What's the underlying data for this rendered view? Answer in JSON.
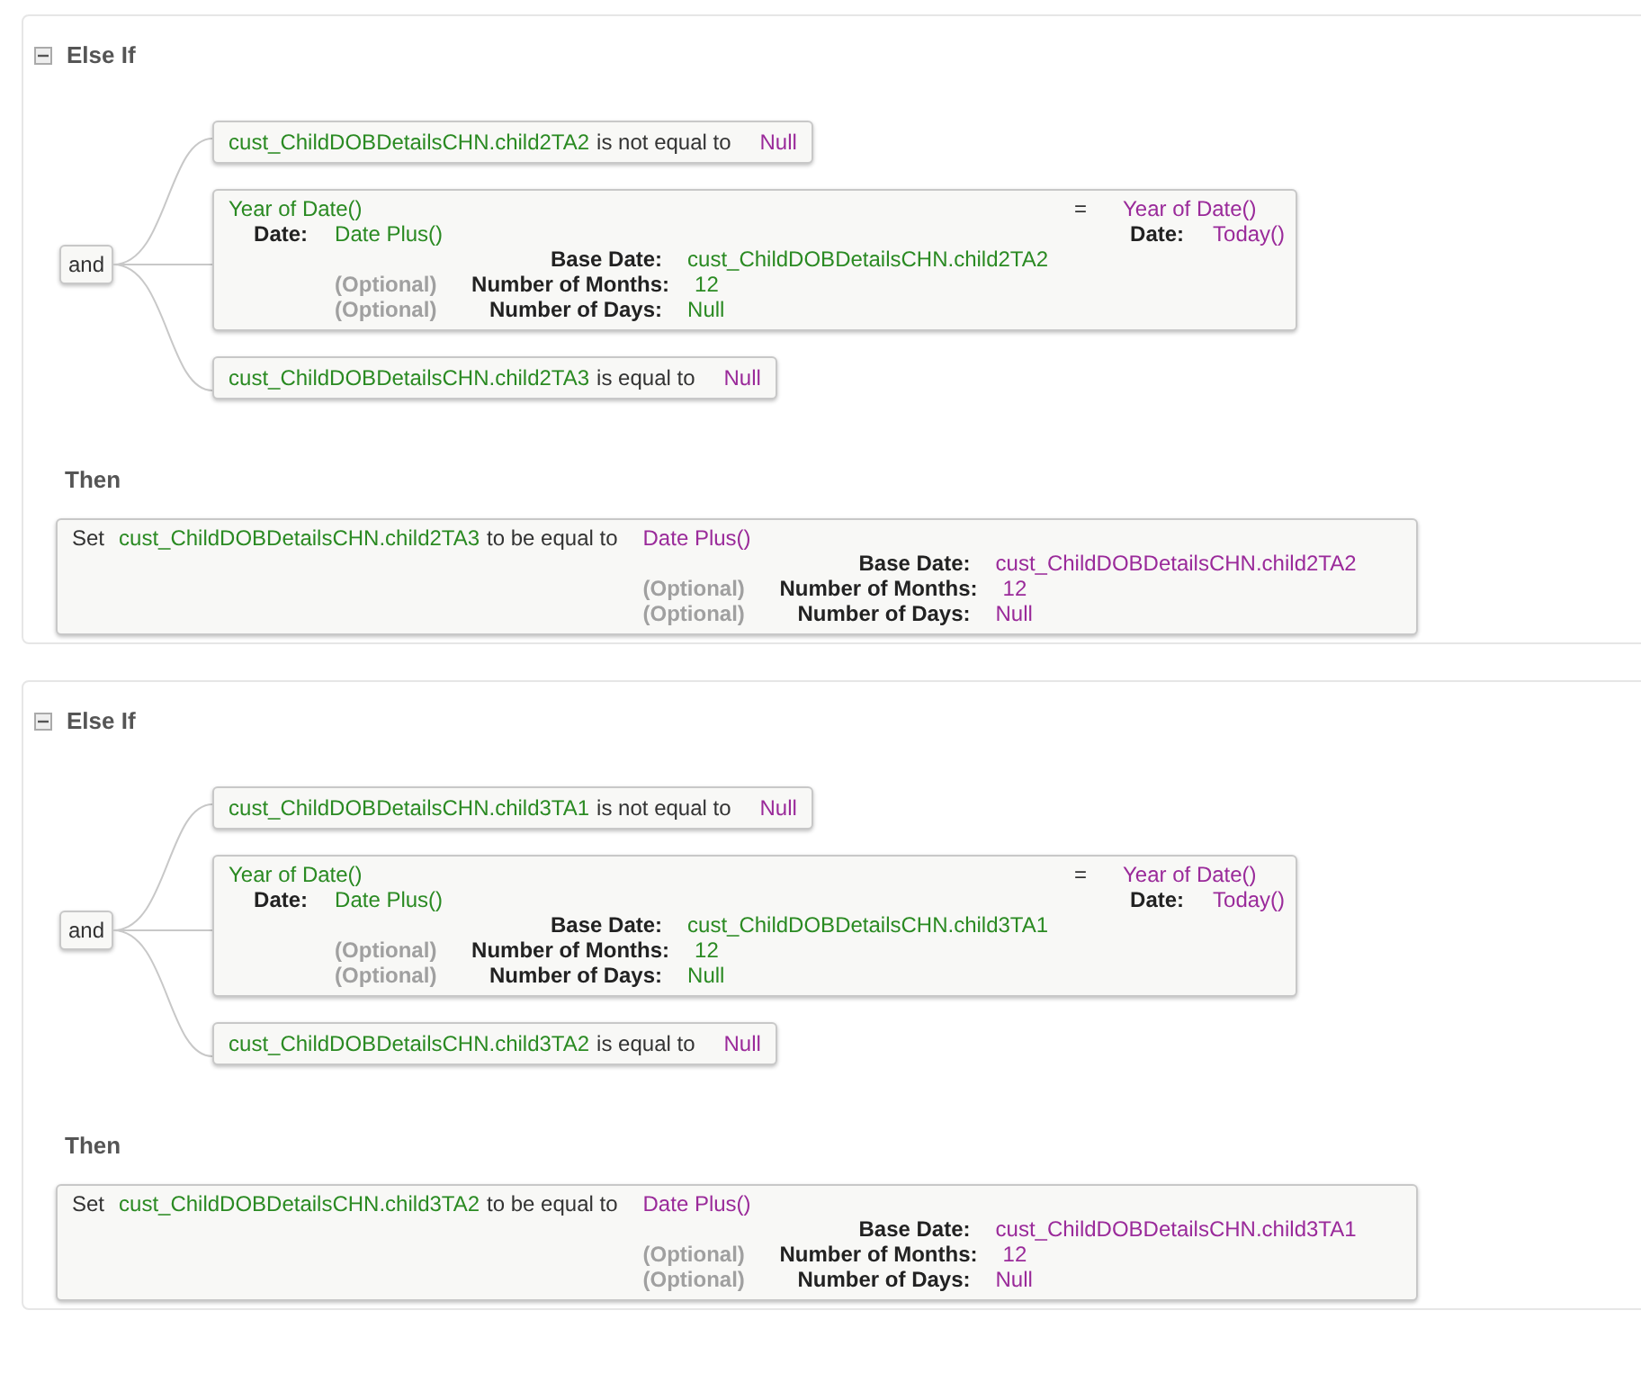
{
  "blocks": [
    {
      "heading": "Else If",
      "expanded": true,
      "operator": "and",
      "conditions": [
        {
          "kind": "compare",
          "field": "cust_ChildDOBDetailsCHN.child2TA2",
          "operator": "is not equal to",
          "value": "Null"
        },
        {
          "kind": "expression",
          "left": {
            "func": "Year of Date()",
            "arg_label": "Date:",
            "arg_func": "Date Plus()",
            "params": [
              {
                "label": "Base Date:",
                "value": "cust_ChildDOBDetailsCHN.child2TA2"
              },
              {
                "note": "(Optional)",
                "label": "Number of Months:",
                "value": "12"
              },
              {
                "note": "(Optional)",
                "label": "Number of Days:",
                "value": "Null"
              }
            ]
          },
          "operator": "=",
          "right": {
            "func": "Year of Date()",
            "arg_label": "Date:",
            "arg_value": "Today()"
          }
        },
        {
          "kind": "compare",
          "field": "cust_ChildDOBDetailsCHN.child2TA3",
          "operator": "is equal to",
          "value": "Null"
        }
      ],
      "then": {
        "heading": "Then",
        "verb": "Set",
        "field": "cust_ChildDOBDetailsCHN.child2TA3",
        "operator": "to be equal to",
        "func": "Date Plus()",
        "params": [
          {
            "label": "Base Date:",
            "value": "cust_ChildDOBDetailsCHN.child2TA2"
          },
          {
            "note": "(Optional)",
            "label": "Number of Months:",
            "value": "12"
          },
          {
            "note": "(Optional)",
            "label": "Number of Days:",
            "value": "Null"
          }
        ]
      }
    },
    {
      "heading": "Else If",
      "expanded": true,
      "operator": "and",
      "conditions": [
        {
          "kind": "compare",
          "field": "cust_ChildDOBDetailsCHN.child3TA1",
          "operator": "is not equal to",
          "value": "Null"
        },
        {
          "kind": "expression",
          "left": {
            "func": "Year of Date()",
            "arg_label": "Date:",
            "arg_func": "Date Plus()",
            "params": [
              {
                "label": "Base Date:",
                "value": "cust_ChildDOBDetailsCHN.child3TA1"
              },
              {
                "note": "(Optional)",
                "label": "Number of Months:",
                "value": "12"
              },
              {
                "note": "(Optional)",
                "label": "Number of Days:",
                "value": "Null"
              }
            ]
          },
          "operator": "=",
          "right": {
            "func": "Year of Date()",
            "arg_label": "Date:",
            "arg_value": "Today()"
          }
        },
        {
          "kind": "compare",
          "field": "cust_ChildDOBDetailsCHN.child3TA2",
          "operator": "is equal to",
          "value": "Null"
        }
      ],
      "then": {
        "heading": "Then",
        "verb": "Set",
        "field": "cust_ChildDOBDetailsCHN.child3TA2",
        "operator": "to be equal to",
        "func": "Date Plus()",
        "params": [
          {
            "label": "Base Date:",
            "value": "cust_ChildDOBDetailsCHN.child3TA1"
          },
          {
            "note": "(Optional)",
            "label": "Number of Months:",
            "value": "12"
          },
          {
            "note": "(Optional)",
            "label": "Number of Days:",
            "value": "Null"
          }
        ]
      }
    }
  ]
}
